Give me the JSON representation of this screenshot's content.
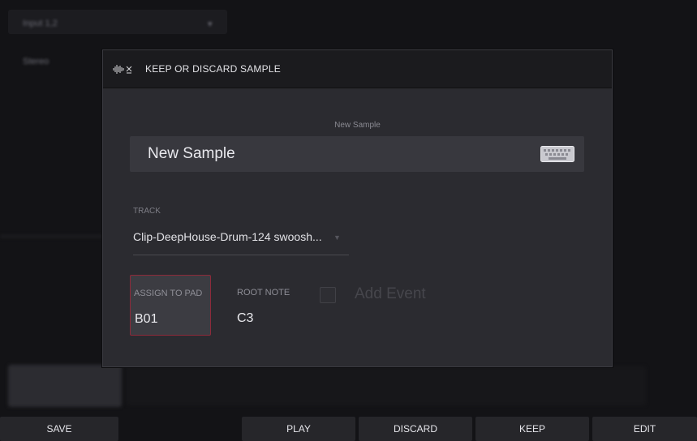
{
  "dialog": {
    "title": "KEEP OR DISCARD SAMPLE",
    "name_label": "New Sample",
    "name_value": "New Sample",
    "track_label": "TRACK",
    "track_value": "Clip-DeepHouse-Drum-124 swoosh...",
    "assign_label": "ASSIGN TO PAD",
    "assign_value": "B01",
    "root_label": "ROOT NOTE",
    "root_value": "C3",
    "add_event_label": "Add Event",
    "add_event_checked": false
  },
  "background": {
    "input_value": "Input 1,2",
    "mode_value": "Stereo"
  },
  "buttons": {
    "save": "SAVE",
    "play": "PLAY",
    "discard": "DISCARD",
    "keep": "KEEP",
    "edit": "EDIT"
  },
  "icons": {
    "header": "sample-waveform-icon",
    "keyboard": "keyboard-icon",
    "caret": "chevron-down-icon"
  },
  "colors": {
    "accent_border": "#8d2a3a",
    "dialog_bg": "#2b2b30",
    "header_bg": "#1b1b1e"
  }
}
